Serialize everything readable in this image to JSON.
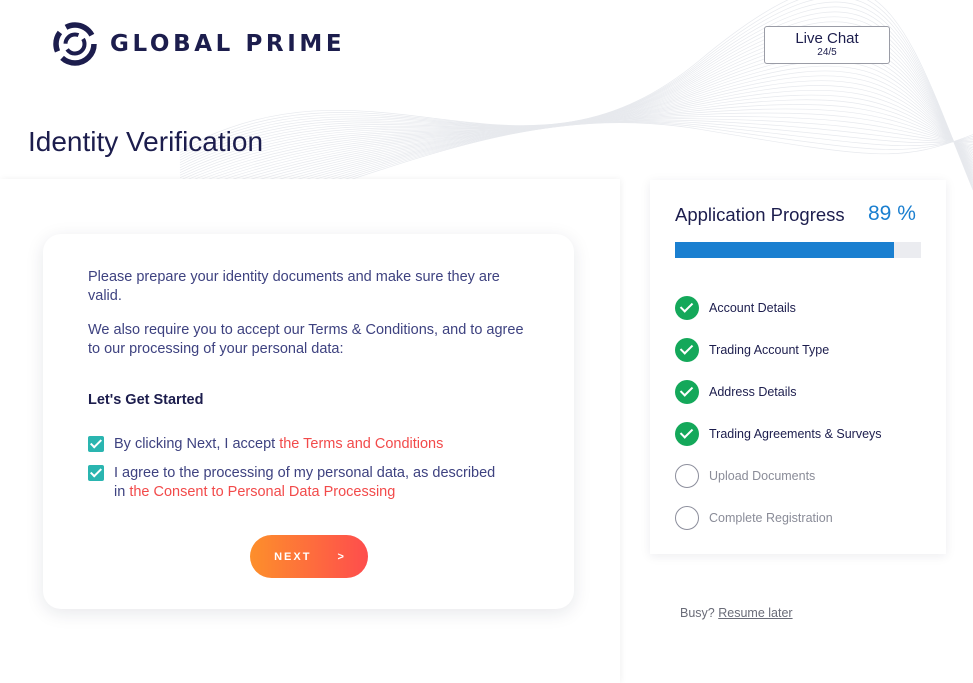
{
  "brand": {
    "name": "GLOBAL PRIME",
    "logo_icon": "global-prime-ring-logo"
  },
  "header": {
    "live_chat_title": "Live Chat",
    "live_chat_sub": "24/5"
  },
  "page": {
    "title": "Identity Verification"
  },
  "form": {
    "intro_1": "Please prepare your identity documents and make sure they are valid.",
    "intro_2": "We also require you to accept our Terms & Conditions, and to agree to our processing of your personal data:",
    "heading": "Let's Get Started",
    "consent_1_text": "By clicking Next, I accept ",
    "consent_1_link": "the Terms and Conditions",
    "consent_1_checked": true,
    "consent_2_text": "I agree to the processing of my personal data, as described in ",
    "consent_2_link": "the Consent to Personal Data Processing",
    "consent_2_checked": true,
    "next_label": "NEXT",
    "next_arrow": ">"
  },
  "progress": {
    "title": "Application Progress",
    "percent_label": "89 %",
    "percent_value": 89,
    "steps": [
      {
        "label": "Account Details",
        "done": true
      },
      {
        "label": "Trading Account Type",
        "done": true
      },
      {
        "label": "Address Details",
        "done": true
      },
      {
        "label": "Trading Agreements & Surveys",
        "done": true
      },
      {
        "label": "Upload Documents",
        "done": false
      },
      {
        "label": "Complete Registration",
        "done": false
      }
    ]
  },
  "footer": {
    "busy_text": "Busy?",
    "resume_label": "Resume later"
  },
  "colors": {
    "brand_navy": "#1c1d4d",
    "accent_blue": "#1a7fd0",
    "success_green": "#14a85a",
    "checkbox_teal": "#2ab5b0",
    "link_red": "#f24a4a",
    "button_gradient_start": "#fd8f2b",
    "button_gradient_end": "#fe4d4d"
  }
}
